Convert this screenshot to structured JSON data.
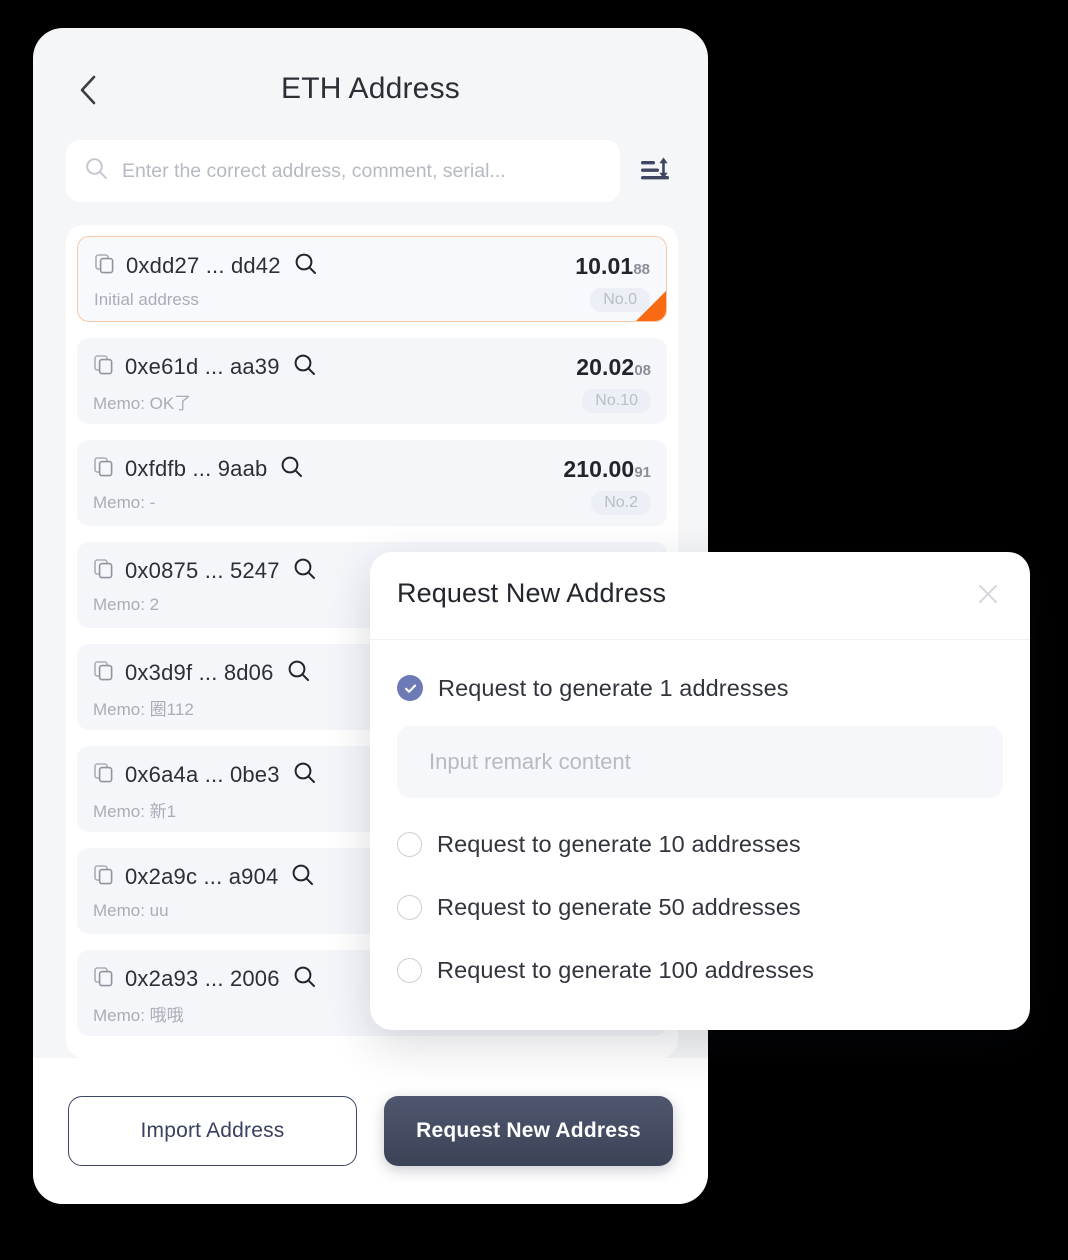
{
  "header": {
    "title": "ETH Address",
    "back_icon": "chevron-left-icon"
  },
  "search": {
    "placeholder": "Enter the correct address, comment, serial...",
    "value": "",
    "search_icon": "search-icon",
    "sort_icon": "sort-icon"
  },
  "colors": {
    "accent_orange": "#f96a12",
    "primary_navy": "#3c4357",
    "radio_blue": "#6c7ab5",
    "card_bg": "#f4f6fa",
    "panel_bg": "#f5f6f8"
  },
  "address_list": [
    {
      "address": "0xdd27 ... dd42",
      "balance_main": "10.01",
      "balance_dec": "88",
      "memo": "Initial address",
      "serial": "No.0",
      "highlighted": true
    },
    {
      "address": "0xe61d ... aa39",
      "balance_main": "20.02",
      "balance_dec": "08",
      "memo": "Memo: OK了",
      "serial": "No.10",
      "highlighted": false
    },
    {
      "address": "0xfdfb ... 9aab",
      "balance_main": "210.00",
      "balance_dec": "91",
      "memo": "Memo: -",
      "serial": "No.2",
      "highlighted": false
    },
    {
      "address": "0x0875 ... 5247",
      "balance_main": "",
      "balance_dec": "",
      "memo": "Memo: 2",
      "serial": "",
      "highlighted": false
    },
    {
      "address": "0x3d9f ... 8d06",
      "balance_main": "",
      "balance_dec": "",
      "memo": "Memo: 圈112",
      "serial": "",
      "highlighted": false
    },
    {
      "address": "0x6a4a ... 0be3",
      "balance_main": "",
      "balance_dec": "",
      "memo": "Memo: 新1",
      "serial": "",
      "highlighted": false
    },
    {
      "address": "0x2a9c ... a904",
      "balance_main": "",
      "balance_dec": "",
      "memo": "Memo: uu",
      "serial": "",
      "highlighted": false
    },
    {
      "address": "0x2a93 ... 2006",
      "balance_main": "",
      "balance_dec": "",
      "memo": "Memo: 哦哦",
      "serial": "",
      "highlighted": false
    }
  ],
  "footer": {
    "import_label": "Import Address",
    "request_label": "Request New Address"
  },
  "modal": {
    "title": "Request New Address",
    "close_icon": "close-icon",
    "remark_placeholder": "Input remark content",
    "remark_value": "",
    "options": [
      {
        "label": "Request to generate 1 addresses",
        "selected": true
      },
      {
        "label": "Request to generate 10 addresses",
        "selected": false
      },
      {
        "label": "Request to generate 50 addresses",
        "selected": false
      },
      {
        "label": "Request to generate 100 addresses",
        "selected": false
      }
    ]
  }
}
